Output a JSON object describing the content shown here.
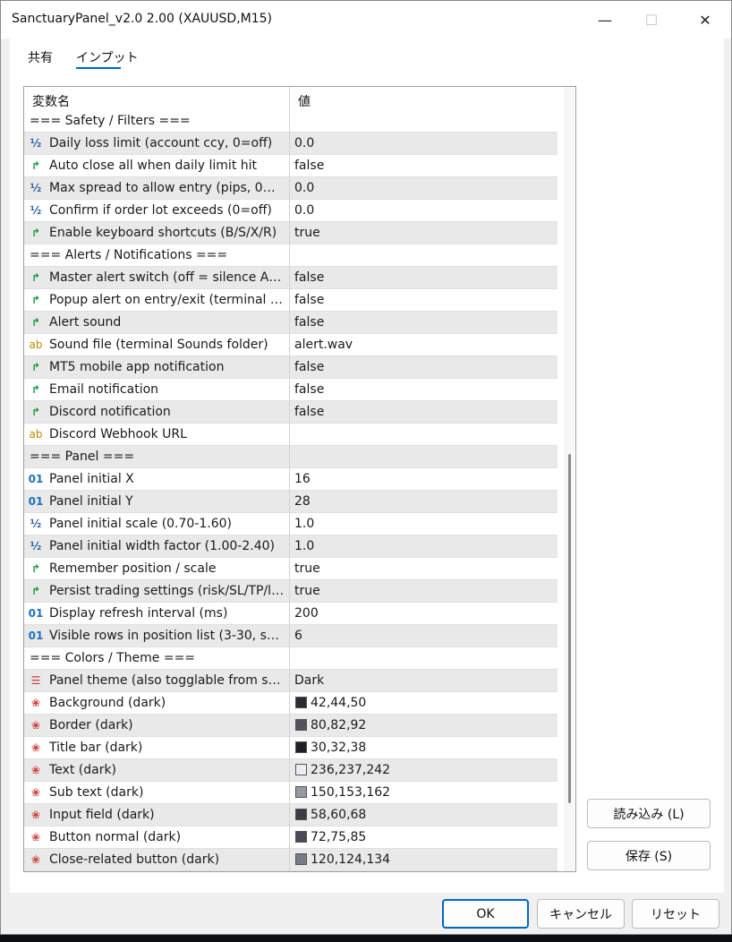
{
  "window": {
    "title": "SanctuaryPanel_v2.0 2.00 (XAUUSD,M15)",
    "minimize_glyph": "—",
    "maximize_glyph": "☐",
    "close_glyph": "✕"
  },
  "tabs": [
    {
      "label": "共有"
    },
    {
      "label": "インプット"
    }
  ],
  "grid": {
    "header": {
      "name": "変数名",
      "value": "値"
    },
    "rows": [
      {
        "type": "section",
        "name": "=== Safety / Filters ==="
      },
      {
        "type": "double",
        "icon": "½",
        "name": "Daily loss limit (account ccy, 0=off)",
        "value": "0.0"
      },
      {
        "type": "bool",
        "icon": "↱",
        "name": "Auto close all when daily limit hit",
        "value": "false"
      },
      {
        "type": "double",
        "icon": "½",
        "name": "Max spread to allow entry (pips, 0=off)",
        "value": "0.0"
      },
      {
        "type": "double",
        "icon": "½",
        "name": "Confirm if order lot exceeds (0=off)",
        "value": "0.0"
      },
      {
        "type": "bool",
        "icon": "↱",
        "name": "Enable keyboard shortcuts (B/S/X/R)",
        "value": "true"
      },
      {
        "type": "section",
        "name": "=== Alerts / Notifications ==="
      },
      {
        "type": "bool",
        "icon": "↱",
        "name": "Master alert switch (off = silence ALL alerts)",
        "value": "false"
      },
      {
        "type": "bool",
        "icon": "↱",
        "name": "Popup alert on entry/exit (terminal popup)",
        "value": "false"
      },
      {
        "type": "bool",
        "icon": "↱",
        "name": "Alert sound",
        "value": "false"
      },
      {
        "type": "string",
        "icon": "ab",
        "name": "Sound file (terminal Sounds folder)",
        "value": "alert.wav"
      },
      {
        "type": "bool",
        "icon": "↱",
        "name": "MT5 mobile app notification",
        "value": "false"
      },
      {
        "type": "bool",
        "icon": "↱",
        "name": "Email notification",
        "value": "false"
      },
      {
        "type": "bool",
        "icon": "↱",
        "name": "Discord notification",
        "value": "false"
      },
      {
        "type": "string",
        "icon": "ab",
        "name": "Discord Webhook URL",
        "value": ""
      },
      {
        "type": "section",
        "name": "=== Panel ==="
      },
      {
        "type": "int",
        "icon": "01",
        "name": "Panel initial X",
        "value": "16"
      },
      {
        "type": "int",
        "icon": "01",
        "name": "Panel initial Y",
        "value": "28"
      },
      {
        "type": "double",
        "icon": "½",
        "name": "Panel initial scale (0.70-1.60)",
        "value": "1.0"
      },
      {
        "type": "double",
        "icon": "½",
        "name": "Panel initial width factor (1.00-2.40)",
        "value": "1.0"
      },
      {
        "type": "bool",
        "icon": "↱",
        "name": "Remember position / scale",
        "value": "true"
      },
      {
        "type": "bool",
        "icon": "↱",
        "name": "Persist trading settings (risk/SL/TP/lot/...",
        "value": "true"
      },
      {
        "type": "int",
        "icon": "01",
        "name": "Display refresh interval (ms)",
        "value": "200"
      },
      {
        "type": "int",
        "icon": "01",
        "name": "Visible rows in position list (3-30, scroll)",
        "value": "6"
      },
      {
        "type": "section",
        "name": "=== Colors / Theme ==="
      },
      {
        "type": "enum",
        "icon": "☰",
        "name": "Panel theme (also togglable from settings)",
        "value": "Dark"
      },
      {
        "type": "color",
        "icon": "❀",
        "name": "Background (dark)",
        "value": "42,44,50",
        "swatch": "#2a2c32"
      },
      {
        "type": "color",
        "icon": "❀",
        "name": "Border (dark)",
        "value": "80,82,92",
        "swatch": "#50525c"
      },
      {
        "type": "color",
        "icon": "❀",
        "name": "Title bar (dark)",
        "value": "30,32,38",
        "swatch": "#1e2026"
      },
      {
        "type": "color",
        "icon": "❀",
        "name": "Text (dark)",
        "value": "236,237,242",
        "swatch": "#ecedf2"
      },
      {
        "type": "color",
        "icon": "❀",
        "name": "Sub text (dark)",
        "value": "150,153,162",
        "swatch": "#9699a2"
      },
      {
        "type": "color",
        "icon": "❀",
        "name": "Input field (dark)",
        "value": "58,60,68",
        "swatch": "#3a3c44"
      },
      {
        "type": "color",
        "icon": "❀",
        "name": "Button normal (dark)",
        "value": "72,75,85",
        "swatch": "#484b55"
      },
      {
        "type": "color",
        "icon": "❀",
        "name": "Close-related button (dark)",
        "value": "120,124,134",
        "swatch": "#787c86"
      }
    ]
  },
  "side_buttons": {
    "load": "読み込み (L)",
    "save": "保存 (S)"
  },
  "footer_buttons": {
    "ok": "OK",
    "cancel": "キャンセル",
    "reset": "リセット"
  },
  "colors": {
    "accent": "#0067c0",
    "double_icon": "#2a5fa0",
    "bool_icon": "#1a9a3a",
    "string_icon": "#c08a00",
    "int_icon": "#1f6fbf",
    "enum_icon": "#c83a3a"
  }
}
